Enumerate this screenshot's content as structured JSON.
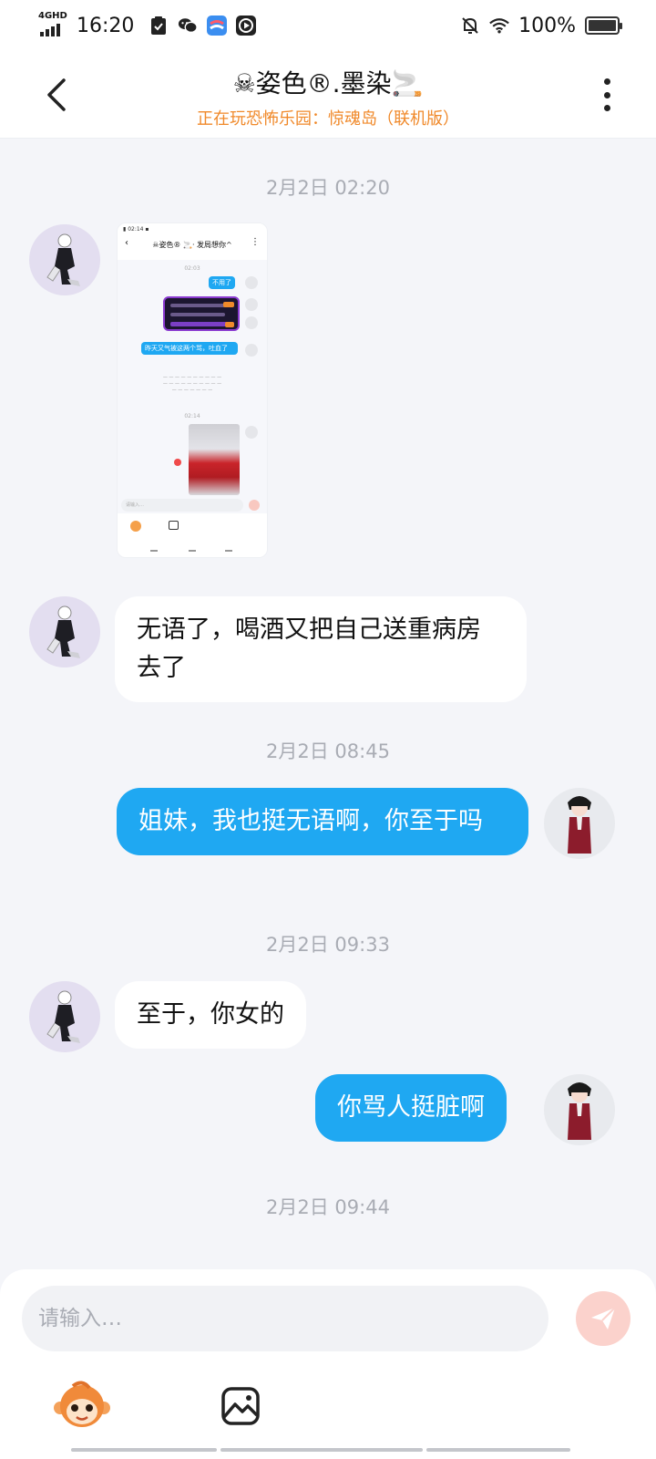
{
  "status_bar": {
    "network": "4GHD",
    "time": "16:20",
    "battery": "100%",
    "battery_level": 1.0
  },
  "header": {
    "title": "☠姿色®.墨染🚬",
    "subtitle": "正在玩恐怖乐园：惊魂岛（联机版）"
  },
  "messages": [
    {
      "type": "timestamp",
      "text": "2月2日 02:20"
    },
    {
      "type": "image",
      "from": "peer",
      "description_hidden": true
    },
    {
      "type": "text",
      "from": "peer",
      "text": "无语了，喝酒又把自己送重病房去了"
    },
    {
      "type": "timestamp",
      "text": "2月2日 08:45"
    },
    {
      "type": "text",
      "from": "me",
      "text": "姐妹，我也挺无语啊，你至于吗"
    },
    {
      "type": "timestamp",
      "text": "2月2日 09:33"
    },
    {
      "type": "text",
      "from": "peer",
      "text": "至于，你女的"
    },
    {
      "type": "text",
      "from": "me",
      "text": "你骂人挺脏啊"
    },
    {
      "type": "timestamp",
      "text": "2月2日 09:44"
    }
  ],
  "image_message": {
    "mini_time": "02:03",
    "mini_bubble_1": "不用了",
    "mini_bubble_2": "昨天又气被这两个骂，吐血了",
    "mini_ts_2": "02:14",
    "mini_input": "请输入…"
  },
  "composer": {
    "placeholder": "请输入…",
    "value": "",
    "send_icon": "send-icon",
    "emoji_icon": "monkey-emoji-icon",
    "image_icon": "image-icon"
  },
  "colors": {
    "accent_blue": "#1fa8f2",
    "subtitle_orange": "#f0892a",
    "send_disabled": "#fbd2cc"
  }
}
